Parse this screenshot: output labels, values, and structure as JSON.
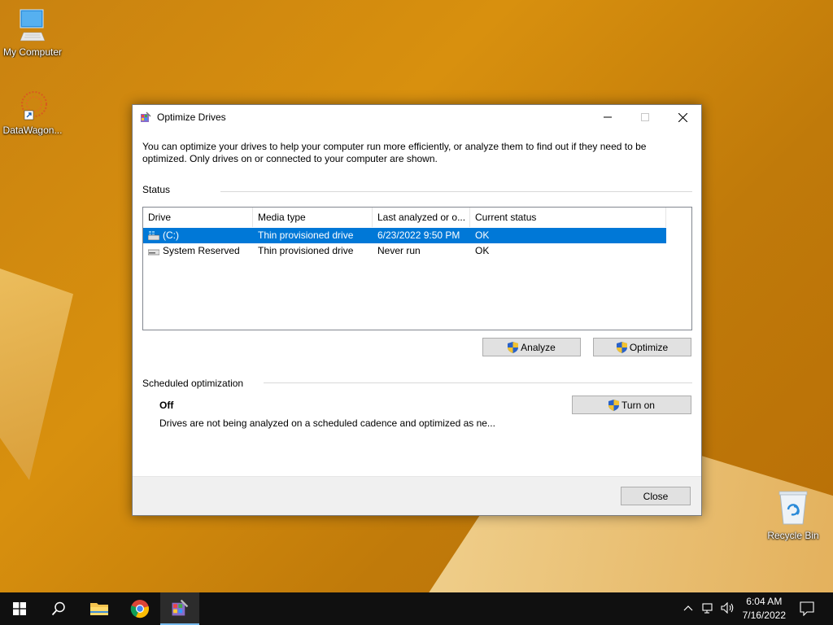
{
  "desktop": {
    "icons": [
      {
        "label": "My Computer",
        "icon": "monitor-icon"
      },
      {
        "label": "DataWagon...",
        "icon": "datawagon-shortcut-icon"
      },
      {
        "label": "Recycle Bin",
        "icon": "recycle-bin-icon"
      }
    ]
  },
  "window": {
    "title": "Optimize Drives",
    "description": "You can optimize your drives to help your computer run more efficiently, or analyze them to find out if they need to be optimized. Only drives on or connected to your computer are shown.",
    "status_label": "Status",
    "columns": [
      "Drive",
      "Media type",
      "Last analyzed or o...",
      "Current status"
    ],
    "drives": [
      {
        "drive": "(C:)",
        "media_type": "Thin provisioned drive",
        "last_analyzed": "6/23/2022 9:50 PM",
        "status": "OK",
        "selected": true
      },
      {
        "drive": "System Reserved",
        "media_type": "Thin provisioned drive",
        "last_analyzed": "Never run",
        "status": "OK",
        "selected": false
      }
    ],
    "analyze_label": "Analyze",
    "optimize_label": "Optimize",
    "scheduled_label": "Scheduled optimization",
    "schedule_state": "Off",
    "schedule_description": "Drives are not being analyzed on a scheduled cadence and optimized as ne...",
    "turn_on_label": "Turn on",
    "close_label": "Close"
  },
  "taskbar": {
    "items": [
      "start",
      "search",
      "file-explorer",
      "chrome",
      "optimize-drives"
    ],
    "time": "6:04 AM",
    "date": "7/16/2022"
  },
  "colors": {
    "selection": "#0078d7",
    "taskbar": "#101010",
    "wallpaper": "#c98210"
  }
}
